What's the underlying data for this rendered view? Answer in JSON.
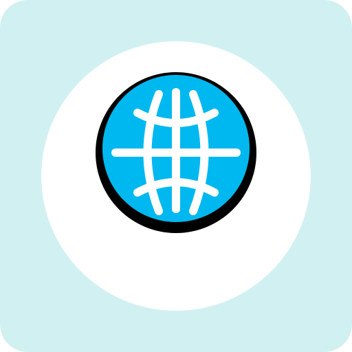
{
  "icon": {
    "name": "globe-icon",
    "colors": {
      "tile_background": "#D1F0F2",
      "circle_background": "#FFFFFF",
      "globe_fill": "#00B8F0",
      "grid_lines": "#FFFFFF",
      "outline": "#000000"
    }
  }
}
